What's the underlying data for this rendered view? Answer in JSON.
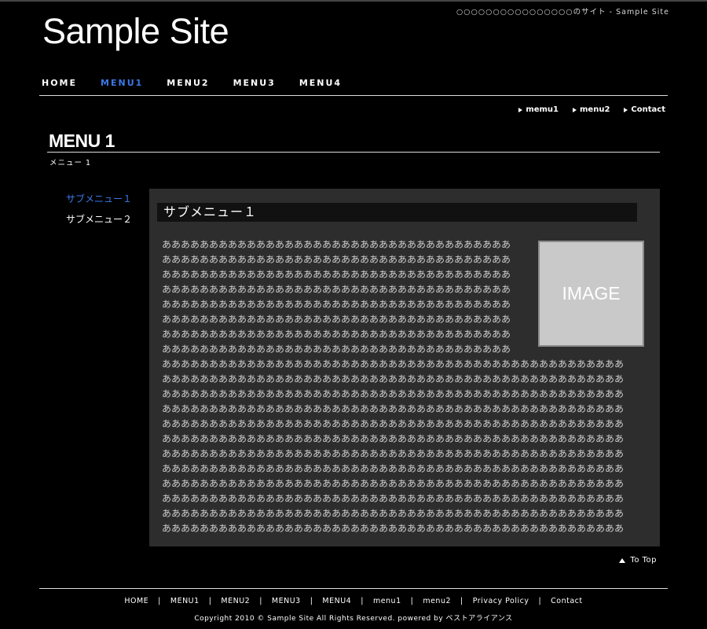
{
  "header": {
    "tagline": "○○○○○○○○○○○○○○○○のサイト - Sample Site",
    "site_title": "Sample Site"
  },
  "global_nav": {
    "items": [
      {
        "label": "HOME"
      },
      {
        "label": "MENU1"
      },
      {
        "label": "MENU2"
      },
      {
        "label": "MENU3"
      },
      {
        "label": "MENU4"
      }
    ],
    "active": "MENU1",
    "active_color": "#3b78e7"
  },
  "utility_nav": {
    "items": [
      {
        "label": "memu1"
      },
      {
        "label": "menu2"
      },
      {
        "label": "Contact"
      }
    ]
  },
  "page": {
    "title": "MENU 1",
    "subtitle": "メニュー 1"
  },
  "sidebar": {
    "items": [
      {
        "label": "サブメニュー１"
      },
      {
        "label": "サブメニュー２"
      }
    ]
  },
  "main": {
    "section_title": "サブメニュー１",
    "image_label": "IMAGE",
    "text_rows": [
      "あああああああああああああああああああああああああああああああああああああ",
      "あああああああああああああああああああああああああああああああああああああ",
      "あああああああああああああああああああああああああああああああああああああ",
      "あああああああああああああああああああああああああああああああああああああ",
      "あああああああああああああああああああああああああああああああああああああ",
      "あああああああああああああああああああああああああああああああああああああ",
      "あああああああああああああああああああああああああああああああああああああ",
      "あああああああああああああああああああああああああああああああああああああ",
      "あああああああああああああああああああああああああああああああああああああああああああああああああ",
      "あああああああああああああああああああああああああああああああああああああああああああああああああ",
      "あああああああああああああああああああああああああああああああああああああああああああああああああ",
      "あああああああああああああああああああああああああああああああああああああああああああああああああ",
      "あああああああああああああああああああああああああああああああああああああああああああああああああ",
      "あああああああああああああああああああああああああああああああああああああああああああああああああ",
      "あああああああああああああああああああああああああああああああああああああああああああああああああ",
      "あああああああああああああああああああああああああああああああああああああああああああああああああ",
      "あああああああああああああああああああああああああああああああああああああああああああああああああ",
      "あああああああああああああああああああああああああああああああああああああああああああああああああ",
      "あああああああああああああああああああああああああああああああああああああああああああああああああ",
      "あああああああああああああああああああああああああああああああああああああああああああああああああ"
    ]
  },
  "to_top": "To Top",
  "footer": {
    "nav": [
      {
        "label": "HOME"
      },
      {
        "label": "MENU1"
      },
      {
        "label": "MENU2"
      },
      {
        "label": "MENU3"
      },
      {
        "label": "MENU4"
      },
      {
        "label": "menu1"
      },
      {
        "label": "menu2"
      },
      {
        "label": "Privacy Policy"
      },
      {
        "label": "Contact"
      }
    ],
    "separator": "|",
    "copyright": "Copyright 2010 © Sample Site All Rights Reserved.  powered by ベストアライアンス"
  }
}
